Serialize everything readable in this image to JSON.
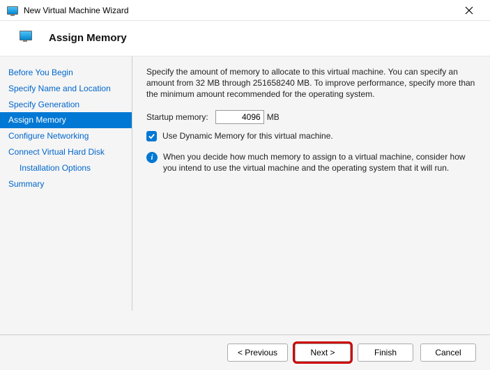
{
  "window": {
    "title": "New Virtual Machine Wizard"
  },
  "header": {
    "title": "Assign Memory"
  },
  "sidebar": {
    "items": [
      {
        "label": "Before You Begin"
      },
      {
        "label": "Specify Name and Location"
      },
      {
        "label": "Specify Generation"
      },
      {
        "label": "Assign Memory"
      },
      {
        "label": "Configure Networking"
      },
      {
        "label": "Connect Virtual Hard Disk"
      },
      {
        "label": "Installation Options"
      },
      {
        "label": "Summary"
      }
    ]
  },
  "content": {
    "description": "Specify the amount of memory to allocate to this virtual machine. You can specify an amount from 32 MB through 251658240 MB. To improve performance, specify more than the minimum amount recommended for the operating system.",
    "startup_label": "Startup memory:",
    "startup_value": "4096",
    "startup_unit": "MB",
    "dynamic_label": "Use Dynamic Memory for this virtual machine.",
    "info": "When you decide how much memory to assign to a virtual machine, consider how you intend to use the virtual machine and the operating system that it will run."
  },
  "footer": {
    "previous": "< Previous",
    "next": "Next >",
    "finish": "Finish",
    "cancel": "Cancel"
  }
}
